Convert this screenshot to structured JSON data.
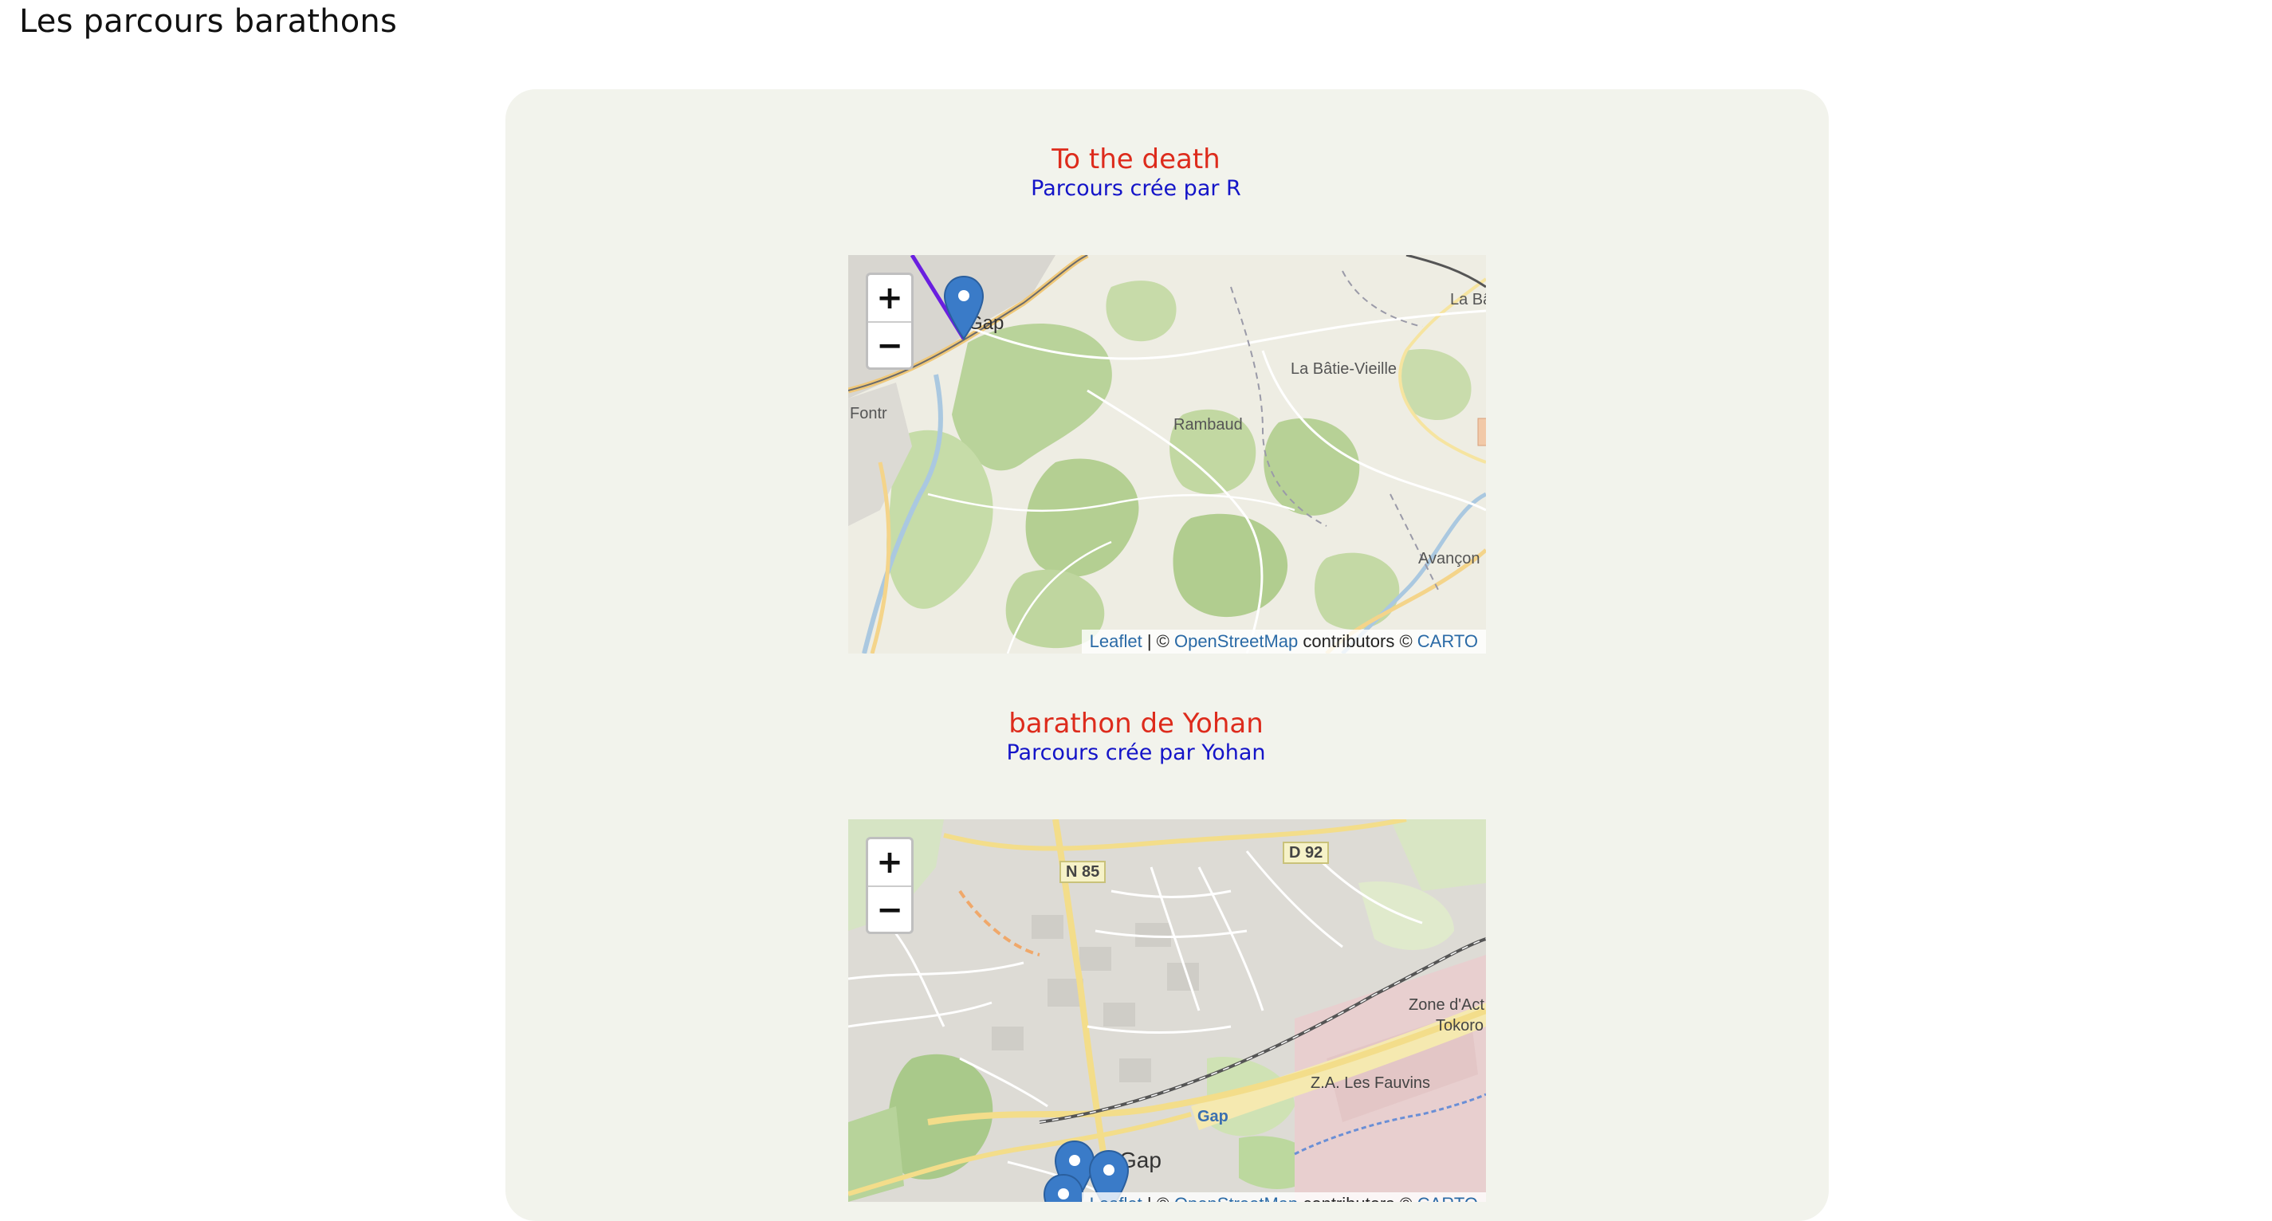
{
  "page": {
    "title": "Les parcours barathons"
  },
  "routes": [
    {
      "title": "To the death",
      "author_line": "Parcours crée par R",
      "map": {
        "zoom_in": "+",
        "zoom_out": "−",
        "attribution": {
          "leaflet": "Leaflet",
          "sep": " | © ",
          "osm": "OpenStreetMap",
          "contrib": " contributors © ",
          "carto": "CARTO"
        },
        "labels": {
          "gap": "Gap",
          "la_batie_vieille": "La Bâtie-Vieille",
          "rambaud": "Rambaud",
          "avancon": "Avançon",
          "la_ba": "La Bâ",
          "fontr": "Fontr"
        },
        "route_color": "#6a1fe0",
        "marker_color": "#3a7bc8"
      }
    },
    {
      "title": "barathon de Yohan",
      "author_line": "Parcours crée par Yohan",
      "map": {
        "zoom_in": "+",
        "zoom_out": "−",
        "attribution": {
          "leaflet": "Leaflet",
          "sep": " | © ",
          "osm": "OpenStreetMap",
          "contrib": " contributors © ",
          "carto": "CARTO"
        },
        "labels": {
          "n85": "N 85",
          "d92": "D 92",
          "zone_dact": "Zone d'Act",
          "tokoro": "Tokoro",
          "za_fauvins": "Z.A. Les Fauvins",
          "gap_station": "Gap",
          "gap": "Gap"
        },
        "marker_color": "#3a7bc8"
      }
    }
  ]
}
